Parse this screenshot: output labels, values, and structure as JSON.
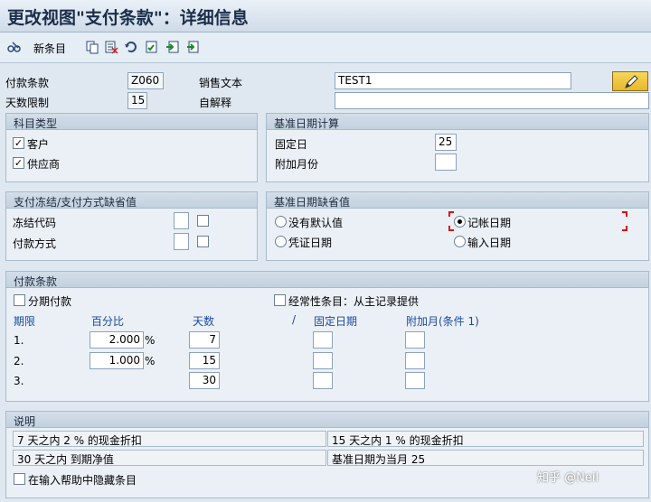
{
  "window": {
    "title": "更改视图\"支付条款\"：详细信息"
  },
  "toolbar": {
    "new_entry_label": "新条目",
    "icons": [
      "edit-glasses-icon",
      "copy-icon",
      "delete-icon",
      "undo-icon",
      "select-all-icon",
      "previous-entry-icon",
      "next-entry-icon"
    ]
  },
  "header": {
    "terms_label": "付款条款",
    "terms_value": "Z060",
    "sales_text_label": "销售文本",
    "sales_text_value": "TEST1",
    "days_limit_label": "天数限制",
    "days_limit_value": "15",
    "own_explanation_label": "自解释",
    "own_explanation_value": ""
  },
  "account_type": {
    "title": "科目类型",
    "customer_label": "客户",
    "customer_checked": true,
    "vendor_label": "供应商",
    "vendor_checked": true
  },
  "baseline_calc": {
    "title": "基准日期计算",
    "fixed_day_label": "固定日",
    "fixed_day_value": "25",
    "extra_month_label": "附加月份",
    "extra_month_value": ""
  },
  "pay_block": {
    "title": "支付冻结/支付方式缺省值",
    "block_key_label": "冻结代码",
    "pay_method_label": "付款方式"
  },
  "baseline_default": {
    "title": "基准日期缺省值",
    "no_default_label": "没有默认值",
    "posting_date_label": "记帐日期",
    "document_date_label": "凭证日期",
    "entry_date_label": "输入日期",
    "selected": "posting_date"
  },
  "payment_terms": {
    "title": "付款条款",
    "installment_label": "分期付款",
    "recurring_label": "经常性条目：从主记录提供",
    "col_term": "期限",
    "col_percent": "百分比",
    "col_days": "天数",
    "col_slash": "/",
    "col_fixed_date": "固定日期",
    "col_extra_month": "附加月(条件 1)",
    "rows": [
      {
        "term": "1.",
        "percent": "2.000",
        "pct_sign": "%",
        "days": "7"
      },
      {
        "term": "2.",
        "percent": "1.000",
        "pct_sign": "%",
        "days": "15"
      },
      {
        "term": "3.",
        "percent": "",
        "pct_sign": "",
        "days": "30"
      }
    ]
  },
  "explanation": {
    "title": "说明",
    "lines": [
      "7 天之内 2 % 的现金折扣",
      "15 天之内 1 % 的现金折扣",
      "30 天之内 到期净值",
      "基准日期为当月 25"
    ],
    "hide_label": "在输入帮助中隐藏条目"
  },
  "watermark": "知乎 @Neil",
  "colors": {
    "title_text": "#1b2d49",
    "group_bg": "#eaf0f6",
    "header_bg": "#c3d1df",
    "label_blue": "#1c4aa0",
    "focus_red": "#dd1111"
  }
}
